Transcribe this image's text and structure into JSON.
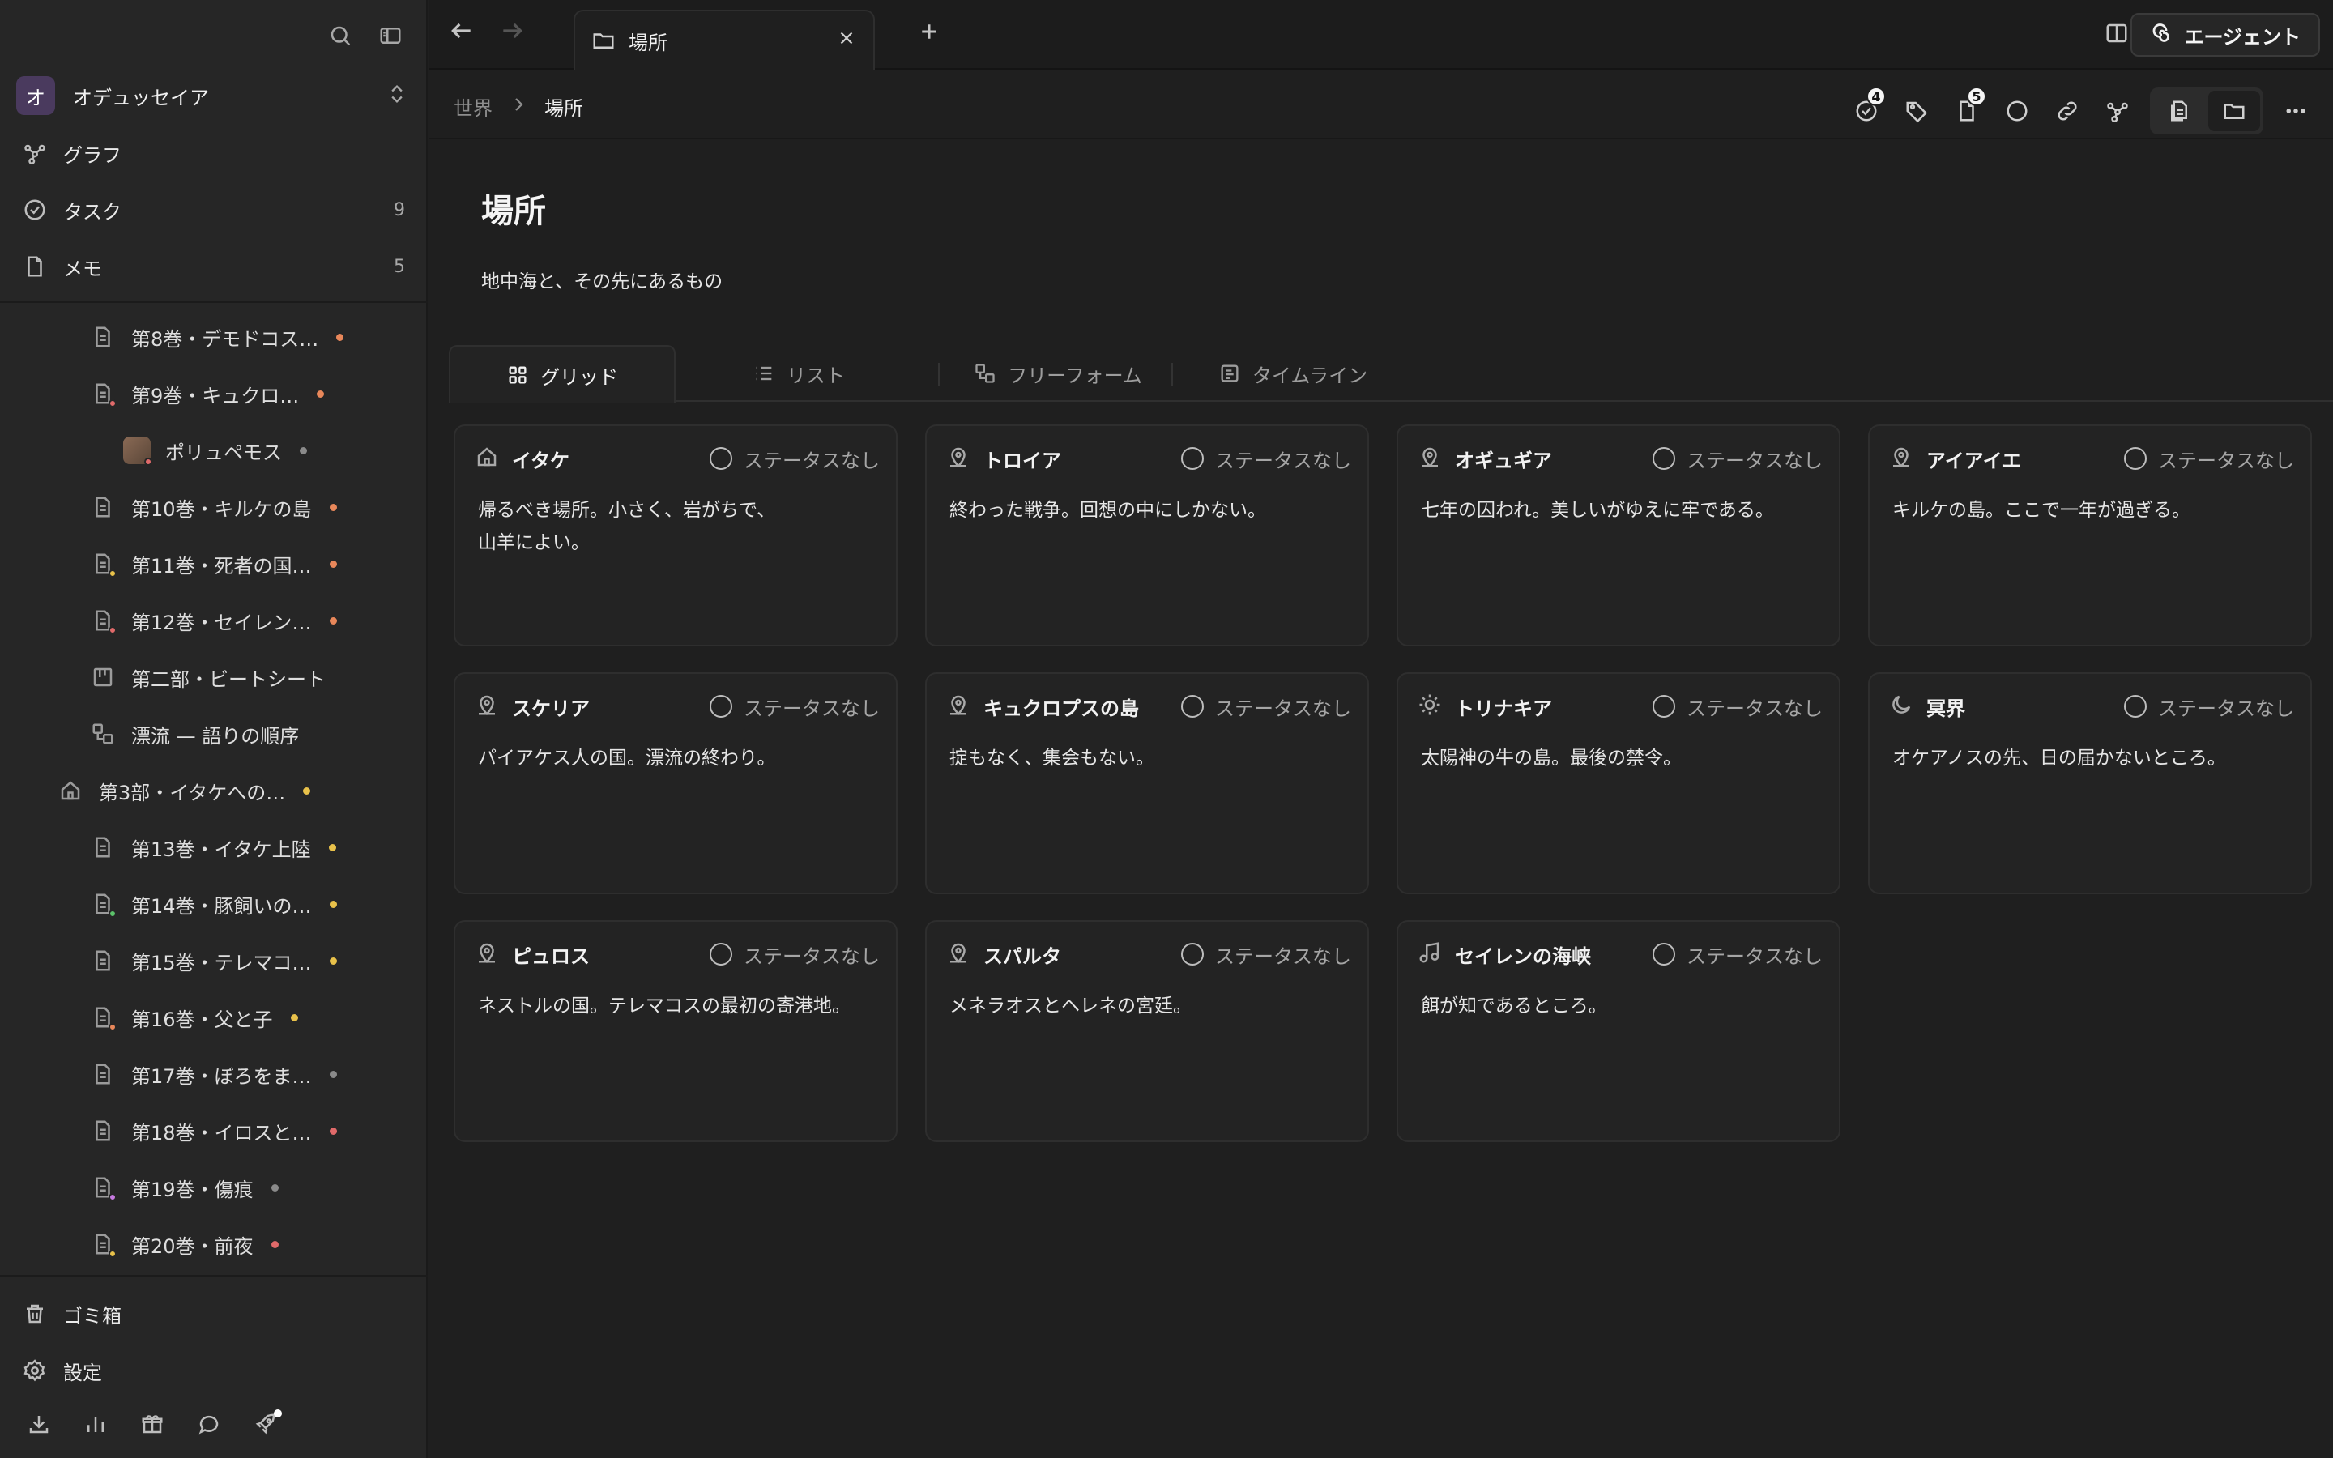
{
  "sidebar": {
    "workspace": {
      "initial": "オ",
      "name": "オデュッセイア"
    },
    "nav": [
      {
        "label": "グラフ",
        "count": ""
      },
      {
        "label": "タスク",
        "count": "9"
      },
      {
        "label": "メモ",
        "count": "5"
      }
    ],
    "tree": [
      {
        "label": "第8巻・デモドコス…",
        "dot": "#e8875a",
        "badge": ""
      },
      {
        "label": "第9巻・キュクロ…",
        "dot": "#e8875a",
        "badge": "#e06a6a"
      },
      {
        "label": "ポリュペモス",
        "dot": "#8a8a8a",
        "badge": "#e06a6a"
      },
      {
        "label": "第10巻・キルケの島",
        "dot": "#e8875a",
        "badge": ""
      },
      {
        "label": "第11巻・死者の国…",
        "dot": "#e8875a",
        "badge": "#e8c14a"
      },
      {
        "label": "第12巻・セイレン…",
        "dot": "#e8875a",
        "badge": "#e06a6a"
      },
      {
        "label": "第二部・ビートシート",
        "dot": "",
        "badge": ""
      },
      {
        "label": "漂流 — 語りの順序",
        "dot": "",
        "badge": ""
      },
      {
        "label": "第3部・イタケへの…",
        "dot": "#e8c14a",
        "badge": ""
      },
      {
        "label": "第13巻・イタケ上陸",
        "dot": "#e8c14a",
        "badge": ""
      },
      {
        "label": "第14巻・豚飼いの…",
        "dot": "#e8c14a",
        "badge": "#5cc26a"
      },
      {
        "label": "第15巻・テレマコ…",
        "dot": "#e8c14a",
        "badge": ""
      },
      {
        "label": "第16巻・父と子",
        "dot": "#e8c14a",
        "badge": "#e8875a"
      },
      {
        "label": "第17巻・ぼろをま…",
        "dot": "#8a8a8a",
        "badge": ""
      },
      {
        "label": "第18巻・イロスと…",
        "dot": "#e06a6a",
        "badge": ""
      },
      {
        "label": "第19巻・傷痕",
        "dot": "#8a8a8a",
        "badge": "#c77ae0"
      },
      {
        "label": "第20巻・前夜",
        "dot": "#e06a6a",
        "badge": "#e8c14a"
      }
    ],
    "trash": "ゴミ箱",
    "settings": "設定"
  },
  "tabbar": {
    "tab_title": "場所",
    "agent_label": "エージェント"
  },
  "breadcrumb": {
    "parent": "世界",
    "current": "場所"
  },
  "toolbar": {
    "tasks_badge": "4",
    "notes_badge": "5"
  },
  "page": {
    "title": "場所",
    "description": "地中海と、その先にあるもの"
  },
  "views": [
    {
      "label": "グリッド",
      "icon": "grid-icon"
    },
    {
      "label": "リスト",
      "icon": "list-icon"
    },
    {
      "label": "フリーフォーム",
      "icon": "freeform-icon"
    },
    {
      "label": "タイムライン",
      "icon": "timeline-icon"
    }
  ],
  "cards": [
    {
      "title": "イタケ",
      "icon": "home-icon",
      "status": "ステータスなし",
      "body": "帰るべき場所。小さく、岩がちで、\n山羊によい。"
    },
    {
      "title": "トロイア",
      "icon": "location-icon",
      "status": "ステータスなし",
      "body": "終わった戦争。回想の中にしかない。"
    },
    {
      "title": "オギュギア",
      "icon": "location-icon",
      "status": "ステータスなし",
      "body": "七年の囚われ。美しいがゆえに牢である。"
    },
    {
      "title": "アイアイエ",
      "icon": "location-icon",
      "status": "ステータスなし",
      "body": "キルケの島。ここで一年が過ぎる。"
    },
    {
      "title": "スケリア",
      "icon": "location-icon",
      "status": "ステータスなし",
      "body": "パイアケス人の国。漂流の終わり。"
    },
    {
      "title": "キュクロプスの島",
      "icon": "location-icon",
      "status": "ステータスなし",
      "body": "掟もなく、集会もない。"
    },
    {
      "title": "トリナキア",
      "icon": "sun-icon",
      "status": "ステータスなし",
      "body": "太陽神の牛の島。最後の禁令。"
    },
    {
      "title": "冥界",
      "icon": "moon-icon",
      "status": "ステータスなし",
      "body": "オケアノスの先、日の届かないところ。"
    },
    {
      "title": "ピュロス",
      "icon": "location-icon",
      "status": "ステータスなし",
      "body": "ネストルの国。テレマコスの最初の寄港地。"
    },
    {
      "title": "スパルタ",
      "icon": "location-icon",
      "status": "ステータスなし",
      "body": "メネラオスとヘレネの宮廷。"
    },
    {
      "title": "セイレンの海峡",
      "icon": "music-icon",
      "status": "ステータスなし",
      "body": "餌が知であるところ。"
    }
  ]
}
